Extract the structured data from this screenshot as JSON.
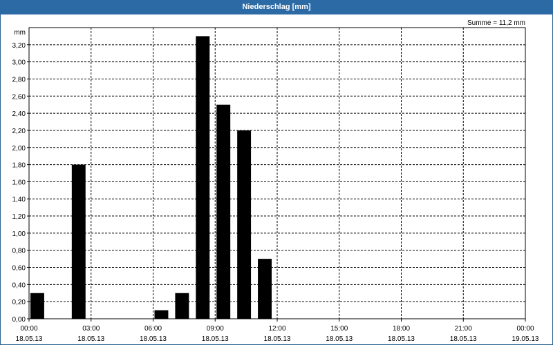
{
  "window": {
    "title": "Niederschlag [mm]"
  },
  "chart_data": {
    "type": "bar",
    "title": "Niederschlag [mm]",
    "ylabel": "mm",
    "annotation": "Summe = 11,2 mm",
    "ylim": [
      0,
      3.4
    ],
    "xlim": [
      0,
      24
    ],
    "grid": true,
    "yticks": [
      0.0,
      0.2,
      0.4,
      0.6,
      0.8,
      1.0,
      1.2,
      1.4,
      1.6,
      1.8,
      2.0,
      2.2,
      2.4,
      2.6,
      2.8,
      3.0,
      3.2
    ],
    "ytick_labels": [
      "0,00",
      "0,20",
      "0,40",
      "0,60",
      "0,80",
      "1,00",
      "1,20",
      "1,40",
      "1,60",
      "1,80",
      "2,00",
      "2,20",
      "2,40",
      "2,60",
      "2,80",
      "3,00",
      "3,20"
    ],
    "xticks": [
      0,
      3,
      6,
      9,
      12,
      15,
      18,
      21,
      24
    ],
    "xtick_labels": [
      {
        "time": "00:00",
        "date": "18.05.13"
      },
      {
        "time": "03:00",
        "date": "18.05.13"
      },
      {
        "time": "06:00",
        "date": "18.05.13"
      },
      {
        "time": "09:00",
        "date": "18.05.13"
      },
      {
        "time": "12:00",
        "date": "18.05.13"
      },
      {
        "time": "15:00",
        "date": "18.05.13"
      },
      {
        "time": "18:00",
        "date": "18.05.13"
      },
      {
        "time": "21:00",
        "date": "18.05.13"
      },
      {
        "time": "00:00",
        "date": "19.05.13"
      }
    ],
    "bars": [
      {
        "hour": 0,
        "value": 0.3
      },
      {
        "hour": 2,
        "value": 1.8
      },
      {
        "hour": 6,
        "value": 0.1
      },
      {
        "hour": 7,
        "value": 0.3
      },
      {
        "hour": 8,
        "value": 3.3
      },
      {
        "hour": 9,
        "value": 2.5
      },
      {
        "hour": 10,
        "value": 2.2
      },
      {
        "hour": 11,
        "value": 0.7
      }
    ],
    "bar_color": "#000000"
  }
}
